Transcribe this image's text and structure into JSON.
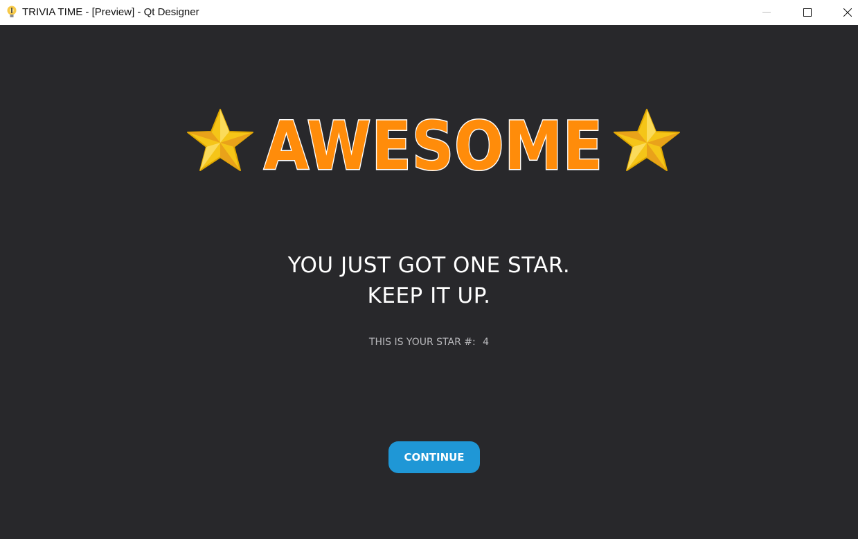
{
  "window": {
    "title": "TRIVIA TIME - [Preview] - Qt Designer",
    "icon": "lightbulb-icon",
    "controls": [
      "minimize-icon",
      "maximize-icon",
      "close-icon"
    ]
  },
  "banner": {
    "text": "AWESOME",
    "left_icon": "star-icon",
    "right_icon": "star-icon",
    "text_color": "#ff8c0a",
    "outline_color": "#ffffff"
  },
  "message": {
    "line1": "YOU JUST GOT ONE STAR.",
    "line2": "KEEP IT UP."
  },
  "star_count": {
    "label": "THIS IS YOUR STAR #:",
    "value": "4"
  },
  "continue_button": {
    "label": "CONTINUE",
    "color": "#1f97d6"
  },
  "colors": {
    "background": "#28282b",
    "star": "#f5c518"
  }
}
